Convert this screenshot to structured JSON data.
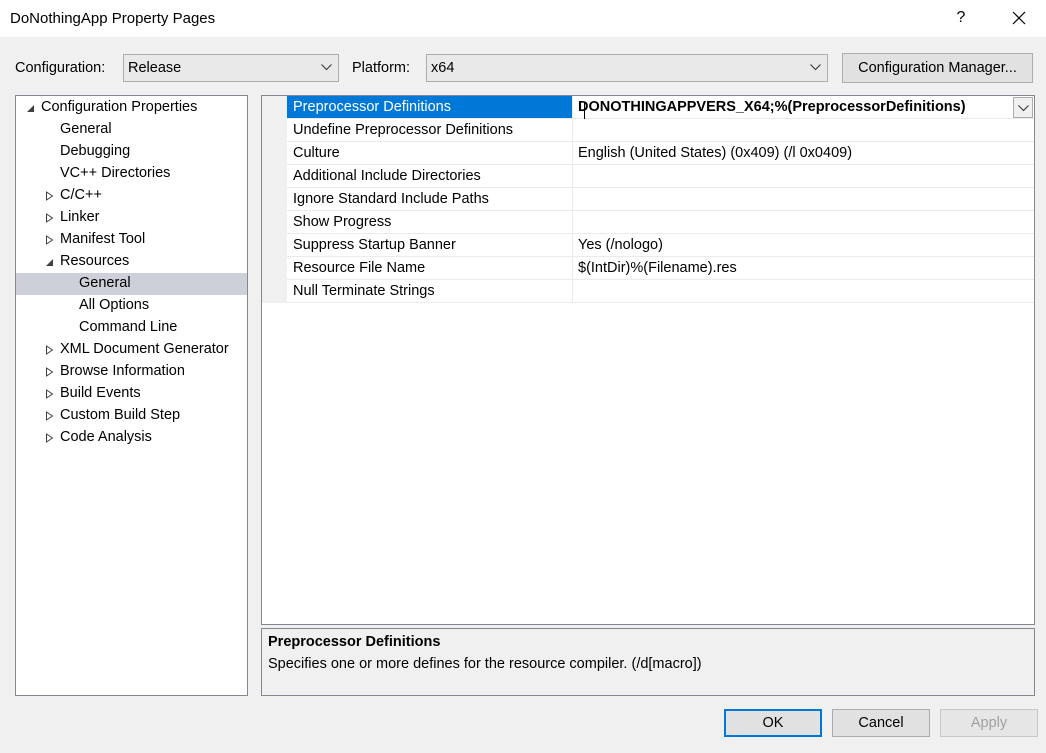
{
  "window": {
    "title": "DoNothingApp Property Pages",
    "help_label": "?"
  },
  "toolbar": {
    "configuration_label": "Configuration:",
    "configuration_value": "Release",
    "platform_label": "Platform:",
    "platform_value": "x64",
    "config_manager_label": "Configuration Manager..."
  },
  "tree": {
    "items": [
      {
        "label": "Configuration Properties",
        "level": 0,
        "expander": "expanded"
      },
      {
        "label": "General",
        "level": 1,
        "expander": "none"
      },
      {
        "label": "Debugging",
        "level": 1,
        "expander": "none"
      },
      {
        "label": "VC++ Directories",
        "level": 1,
        "expander": "none"
      },
      {
        "label": "C/C++",
        "level": 1,
        "expander": "collapsed"
      },
      {
        "label": "Linker",
        "level": 1,
        "expander": "collapsed"
      },
      {
        "label": "Manifest Tool",
        "level": 1,
        "expander": "collapsed"
      },
      {
        "label": "Resources",
        "level": 1,
        "expander": "expanded"
      },
      {
        "label": "General",
        "level": 2,
        "expander": "none",
        "selected": true
      },
      {
        "label": "All Options",
        "level": 2,
        "expander": "none"
      },
      {
        "label": "Command Line",
        "level": 2,
        "expander": "none"
      },
      {
        "label": "XML Document Generator",
        "level": 1,
        "expander": "collapsed"
      },
      {
        "label": "Browse Information",
        "level": 1,
        "expander": "collapsed"
      },
      {
        "label": "Build Events",
        "level": 1,
        "expander": "collapsed"
      },
      {
        "label": "Custom Build Step",
        "level": 1,
        "expander": "collapsed"
      },
      {
        "label": "Code Analysis",
        "level": 1,
        "expander": "collapsed"
      }
    ]
  },
  "properties": [
    {
      "name": "Preprocessor Definitions",
      "value": "DONOTHINGAPPVERS_X64;%(PreprocessorDefinitions)",
      "selected": true
    },
    {
      "name": "Undefine Preprocessor Definitions",
      "value": ""
    },
    {
      "name": "Culture",
      "value": "English (United States) (0x409) (/l 0x0409)"
    },
    {
      "name": "Additional Include Directories",
      "value": ""
    },
    {
      "name": "Ignore Standard Include Paths",
      "value": ""
    },
    {
      "name": "Show Progress",
      "value": ""
    },
    {
      "name": "Suppress Startup Banner",
      "value": "Yes (/nologo)"
    },
    {
      "name": "Resource File Name",
      "value": "$(IntDir)%(Filename).res"
    },
    {
      "name": "Null Terminate Strings",
      "value": ""
    }
  ],
  "description": {
    "title": "Preprocessor Definitions",
    "text": "Specifies one or more defines for the resource compiler. (/d[macro])"
  },
  "buttons": {
    "ok": "OK",
    "cancel": "Cancel",
    "apply": "Apply"
  },
  "colors": {
    "selection_blue": "#0078d7",
    "tree_selection": "#cdd0d8",
    "dialog_bg": "#f0f0f0"
  }
}
